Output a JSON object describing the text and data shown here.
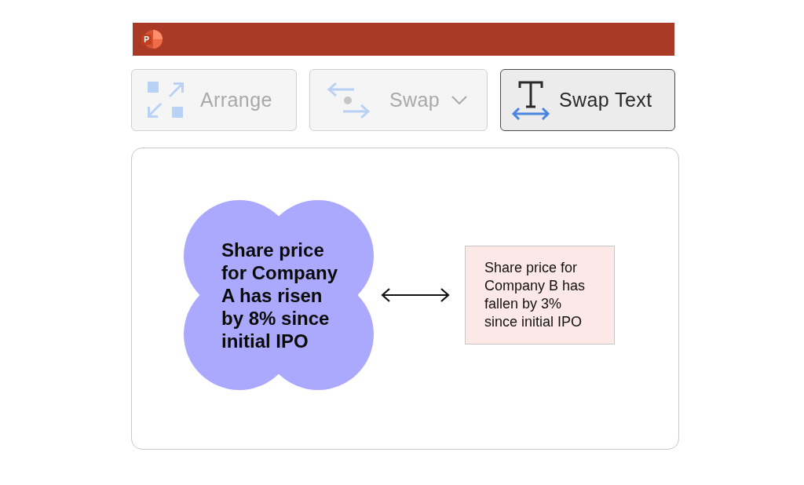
{
  "app_bar": {
    "logo_letter": "P"
  },
  "toolbar": [
    {
      "label": "Arrange",
      "kind": "arrange",
      "disabled": true,
      "dropdown": false
    },
    {
      "label": "Swap",
      "kind": "swap",
      "disabled": true,
      "dropdown": true
    },
    {
      "label": "Swap Text",
      "kind": "swap_text",
      "disabled": false,
      "dropdown": false
    }
  ],
  "slide": {
    "shape_text": "Share price for Company A has risen by 8% since initial IPO",
    "box_text": "Share price for Company B has fallen by 3% since initial IPO"
  }
}
